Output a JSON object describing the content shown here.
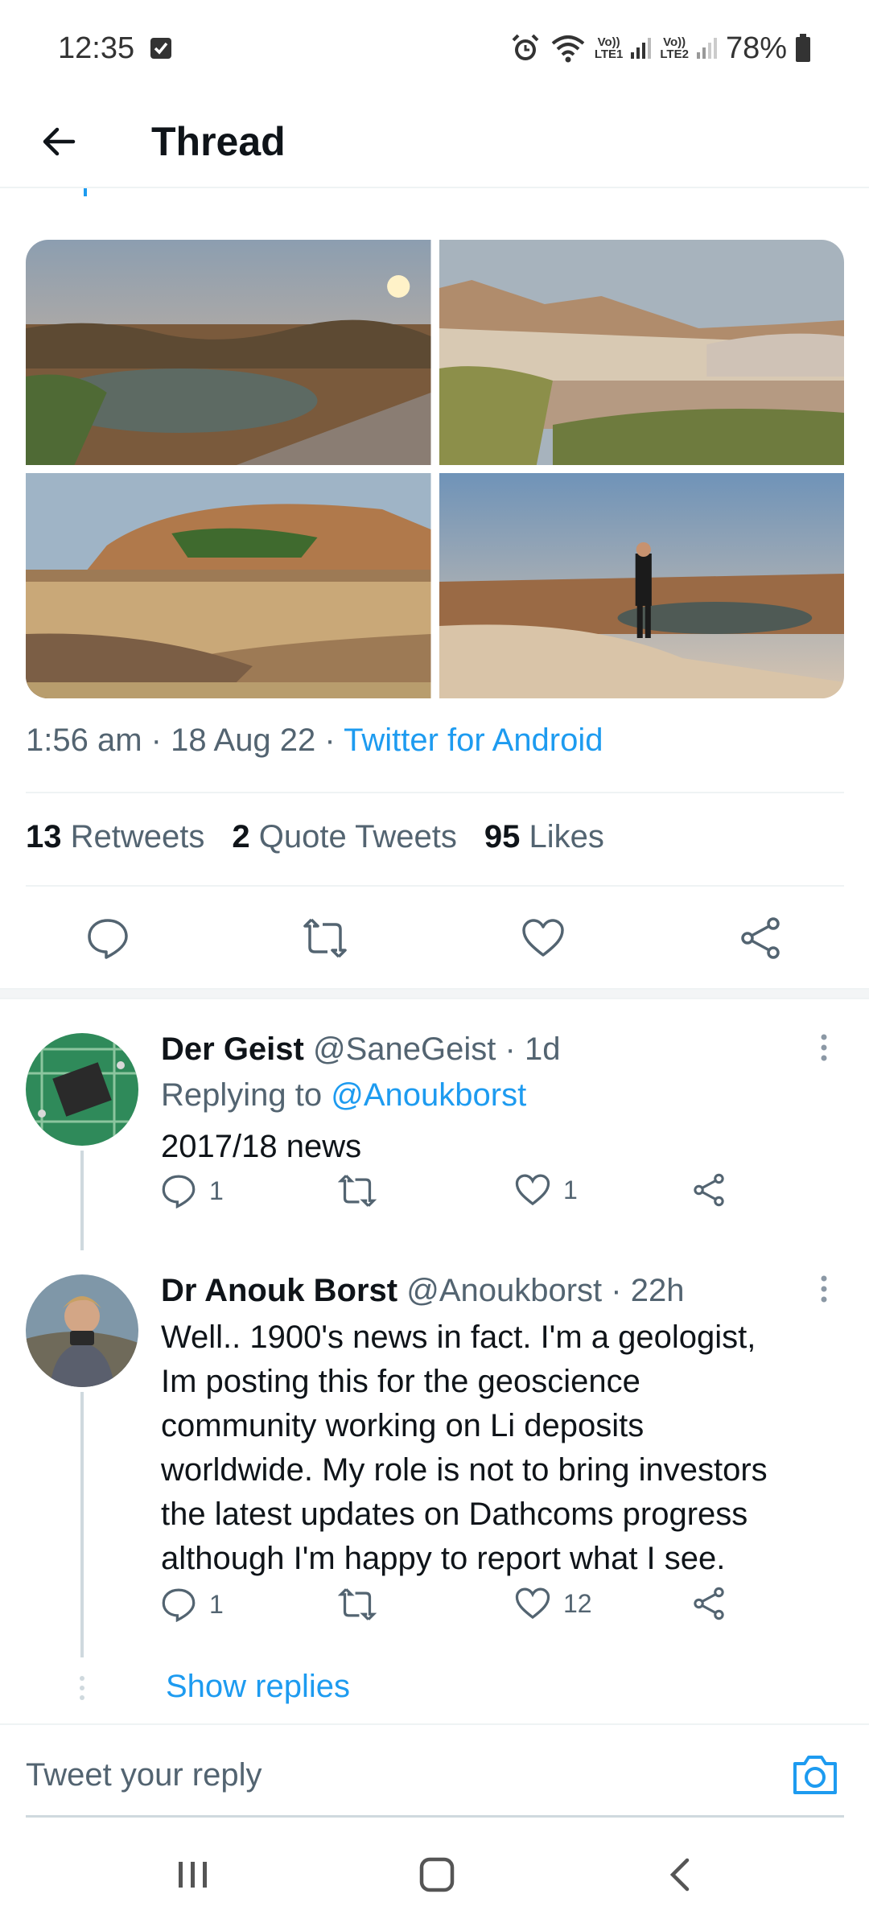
{
  "status_bar": {
    "time": "12:35",
    "lte1": "LTE1",
    "lte2": "LTE2",
    "volte": "Vo))",
    "battery": "78%"
  },
  "header": {
    "title": "Thread"
  },
  "tweet": {
    "time": "1:56 am",
    "date": "18 Aug 22",
    "source": "Twitter for Android",
    "separator": "·",
    "stats": {
      "retweets_count": "13",
      "retweets_label": "Retweets",
      "quote_count": "2",
      "quote_label": "Quote Tweets",
      "likes_count": "95",
      "likes_label": "Likes"
    }
  },
  "replies": [
    {
      "name": "Der Geist",
      "handle": "@SaneGeist",
      "age": "1d",
      "replying_prefix": "Replying to",
      "replying_to": "@Anoukborst",
      "text": "2017/18 news",
      "reply_count": "1",
      "retweet_count": "",
      "like_count": "1"
    },
    {
      "name": "Dr Anouk Borst",
      "handle": "@Anoukborst",
      "age": "22h",
      "text_lines": [
        "Well.. 1900's news in fact. I'm a geologist,",
        "Im posting this for the geoscience",
        "community working on Li deposits",
        "worldwide. My role is not to bring investors",
        "the latest updates on Dathcoms progress",
        "although I'm happy to report what I see."
      ],
      "reply_count": "1",
      "retweet_count": "",
      "like_count": "12"
    }
  ],
  "show_replies": "Show replies",
  "composer": {
    "placeholder": "Tweet your reply"
  },
  "colors": {
    "accent": "#1d9bf0",
    "text": "#0f1419",
    "secondary": "#536471"
  }
}
